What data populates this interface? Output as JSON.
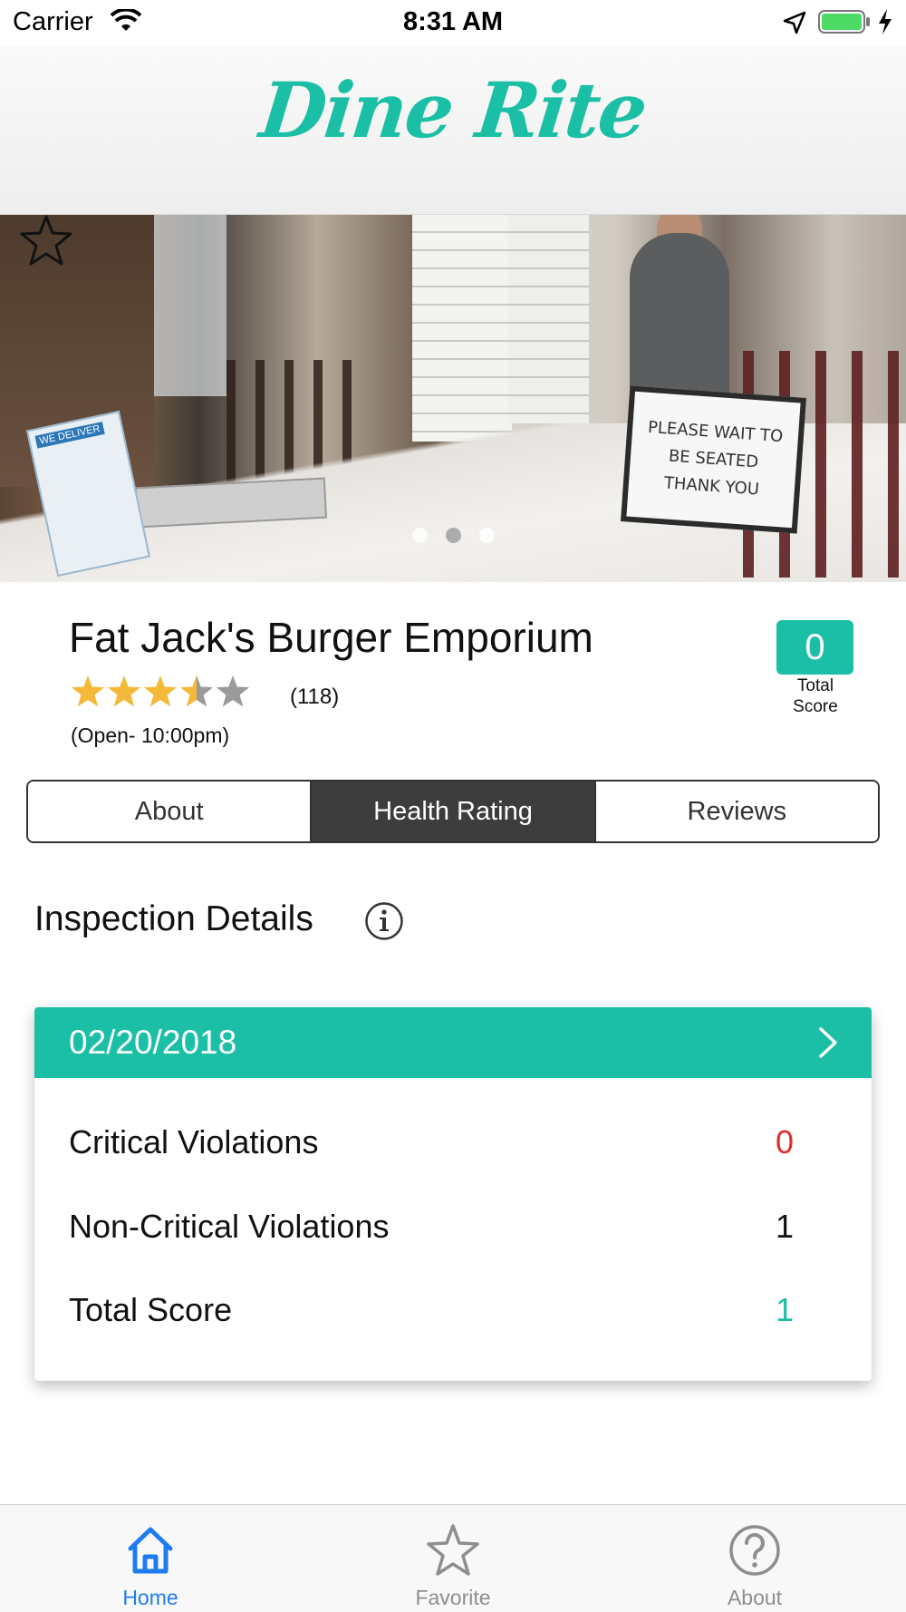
{
  "status_bar": {
    "carrier": "Carrier",
    "time": "8:31 AM"
  },
  "header": {
    "logo_text": "Dine Rite"
  },
  "hero": {
    "sign_lines": [
      "PLEASE WAIT TO",
      "BE SEATED",
      "THANK YOU"
    ],
    "card_text": "WE DELIVER",
    "page_count": 3,
    "active_page": 2
  },
  "restaurant": {
    "name": "Fat Jack's Burger Emporium",
    "rating": 3.5,
    "rating_max": 5,
    "review_count": "(118)",
    "hours": "(Open- 10:00pm)",
    "score": "0",
    "score_label_line1": "Total",
    "score_label_line2": "Score"
  },
  "tabs": [
    {
      "label": "About",
      "active": false
    },
    {
      "label": "Health Rating",
      "active": true
    },
    {
      "label": "Reviews",
      "active": false
    }
  ],
  "inspection": {
    "title": "Inspection Details",
    "date": "02/20/2018",
    "rows": [
      {
        "label": "Critical Violations",
        "value": "0",
        "color": "#e0302b"
      },
      {
        "label": "Non-Critical Violations",
        "value": "1",
        "color": "#111111"
      },
      {
        "label": "Total Score",
        "value": "1",
        "color": "#1bbfa6"
      }
    ]
  },
  "tab_bar": [
    {
      "label": "Home",
      "icon": "home-icon",
      "active": true
    },
    {
      "label": "Favorite",
      "icon": "star-icon",
      "active": false
    },
    {
      "label": "About",
      "icon": "question-icon",
      "active": false
    }
  ],
  "colors": {
    "accent": "#1bbfa6",
    "tab_active": "#1e7cf2",
    "star": "#f5b93a",
    "critical": "#e0302b"
  }
}
